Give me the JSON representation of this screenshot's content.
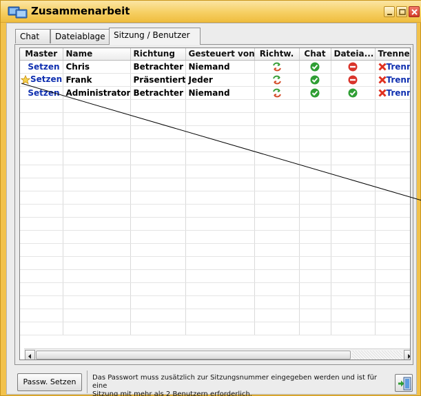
{
  "window": {
    "title": "Zusammenarbeit",
    "accent": "#f2c24c"
  },
  "tabs": [
    {
      "label": "Chat"
    },
    {
      "label": "Dateiablage"
    },
    {
      "label": "Sitzung / Benutzer",
      "selected": true
    }
  ],
  "table": {
    "columns": [
      "Master",
      "Name",
      "Richtung",
      "Gesteuert von",
      "Richtw.",
      "Chat",
      "Dateia...",
      "Trenner"
    ],
    "rows": [
      {
        "master": "Setzen",
        "master_star": false,
        "name": "Chris",
        "richtung": "Betrachter",
        "gesteuert": "Niemand",
        "richtw_icon": "switch-direction-icon",
        "chat_icon": "check-icon",
        "datei_icon": "no-entry-icon",
        "trennen": "Trenne"
      },
      {
        "master": "Setzen",
        "master_star": true,
        "name": "Frank",
        "richtung": "Präsentiert",
        "gesteuert": "Jeder",
        "richtw_icon": "switch-direction-icon",
        "chat_icon": "check-icon",
        "datei_icon": "no-entry-icon",
        "trennen": "Trenne"
      },
      {
        "master": "Setzen",
        "master_star": false,
        "name": "Administrator",
        "richtung": "Betrachter",
        "gesteuert": "Niemand",
        "richtw_icon": "switch-direction-icon",
        "chat_icon": "check-icon",
        "datei_icon": "check-icon",
        "trennen": "Trenne"
      }
    ]
  },
  "footer": {
    "password_button": "Passw. Setzen",
    "notice_line1": "Das Passwort muss zusätzlich zur Sitzungsnummer eingegeben werden und ist für eine",
    "notice_line2": "Sitzung mit mehr als 2 Benutzern erforderlich.",
    "exit_icon": "exit-door-icon"
  },
  "colors": {
    "link": "#1030b0",
    "check": "#2f9e34",
    "no_entry": "#d9342b"
  }
}
